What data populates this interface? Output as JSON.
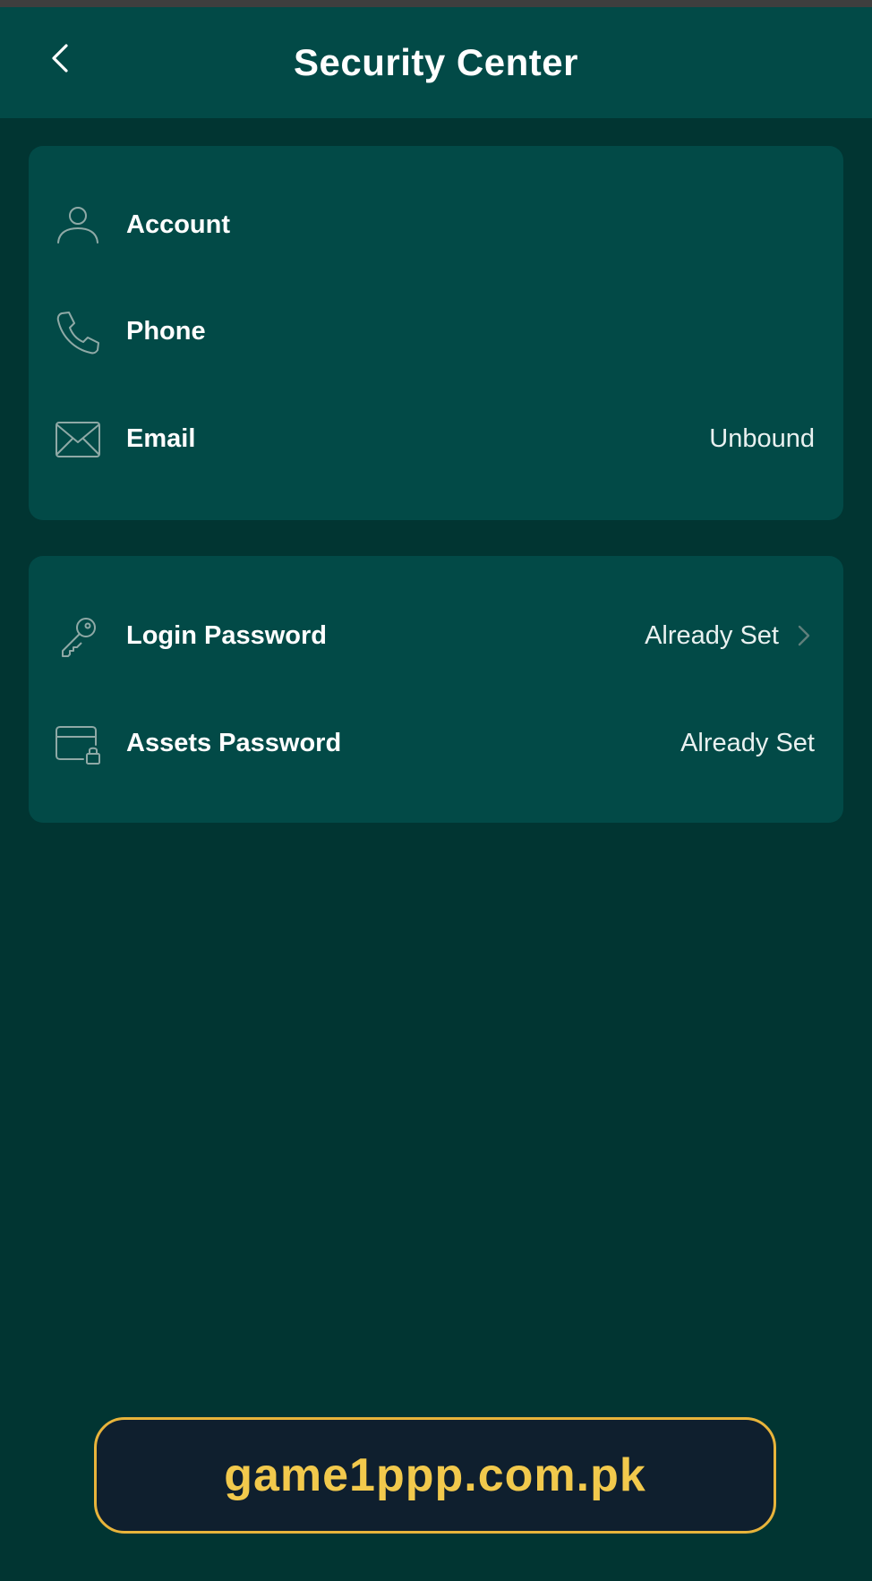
{
  "header": {
    "title": "Security Center",
    "back_icon": "chevron-left-icon"
  },
  "profile_card": {
    "items": [
      {
        "label": "Account",
        "value": "",
        "icon": "user-icon"
      },
      {
        "label": "Phone",
        "value": "",
        "icon": "phone-icon"
      },
      {
        "label": "Email",
        "value": "Unbound",
        "icon": "envelope-icon"
      }
    ]
  },
  "password_card": {
    "items": [
      {
        "label": "Login Password",
        "value": "Already Set",
        "icon": "key-icon",
        "has_chevron": true
      },
      {
        "label": "Assets Password",
        "value": "Already Set",
        "icon": "card-lock-icon",
        "has_chevron": false
      }
    ]
  },
  "watermark": {
    "text": "game1ppp.com.pk"
  },
  "colors": {
    "background": "#013532",
    "header": "#024a47",
    "card": "#024a47",
    "icon_stroke": "#8fa9a6",
    "watermark_border": "#e8b43b",
    "watermark_text": "#f2c94c",
    "watermark_bg": "#0f1f2e"
  }
}
